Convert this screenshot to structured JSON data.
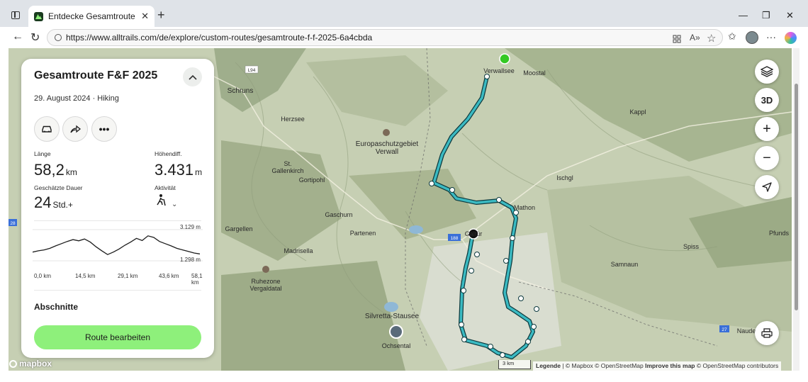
{
  "browser": {
    "tab_title": "Entdecke Gesamtroute F&F 2025",
    "tab_close": "✕",
    "new_tab": "+",
    "url": "https://www.alltrails.com/de/explore/custom-routes/gesamtroute-f-f-2025-6a4cbda",
    "window_min": "—",
    "window_max": "❐",
    "window_close": "✕",
    "back": "←",
    "reload": "↻",
    "more": "···"
  },
  "panel": {
    "title": "Gesamtroute F&F 2025",
    "collapse": "^",
    "date_line": "29. August 2024 · Hiking",
    "stats": {
      "length_label": "Länge",
      "length_value": "58,2",
      "length_unit": "km",
      "elevation_label": "Höhendiff.",
      "elevation_value": "3.431",
      "elevation_unit": "m",
      "duration_label": "Geschätzte Dauer",
      "duration_value": "24",
      "duration_unit": "Std.+",
      "activity_label": "Aktivität"
    },
    "elevation_profile": {
      "max_label": "3.129 m",
      "min_label": "1.298 m",
      "x_labels": [
        "0,0 km",
        "14,5 km",
        "29,1 km",
        "43,6 km",
        "58,1 km"
      ],
      "profile": [
        0.28,
        0.32,
        0.35,
        0.4,
        0.48,
        0.55,
        0.62,
        0.68,
        0.64,
        0.7,
        0.6,
        0.45,
        0.32,
        0.2,
        0.28,
        0.38,
        0.5,
        0.6,
        0.72,
        0.65,
        0.8,
        0.75,
        0.62,
        0.55,
        0.48,
        0.4,
        0.35,
        0.3,
        0.25,
        0.22
      ]
    },
    "section_heading": "Abschnitte",
    "edit_button": "Route bearbeiten"
  },
  "map": {
    "labels": [
      {
        "text": "Verwallsee"
      },
      {
        "text": "Moostal"
      },
      {
        "text": "Schruns"
      },
      {
        "text": "L94"
      },
      {
        "text": "Herzsee"
      },
      {
        "text": "Kappl"
      },
      {
        "text": "Europaschutzgebiet"
      },
      {
        "text": "Verwall"
      },
      {
        "text": "St."
      },
      {
        "text": "Gallenkirch"
      },
      {
        "text": "Gortipohl"
      },
      {
        "text": "Ischgl"
      },
      {
        "text": "Mathon"
      },
      {
        "text": "Gaschurn"
      },
      {
        "text": "Partenen"
      },
      {
        "text": "Gargellen"
      },
      {
        "text": "Galtür"
      },
      {
        "text": "188"
      },
      {
        "text": "Pfunds"
      },
      {
        "text": "Madrisella"
      },
      {
        "text": "Spiss"
      },
      {
        "text": "Samnaun"
      },
      {
        "text": "Ruhezone"
      },
      {
        "text": "Vergaldatal"
      },
      {
        "text": "28"
      },
      {
        "text": "Silvretta-Stausee"
      },
      {
        "text": "Ochsental"
      },
      {
        "text": "27"
      },
      {
        "text": "Naude"
      }
    ],
    "scale_text": "3 km",
    "logo_text": "mapbox",
    "attribution": {
      "legend": "Legende",
      "mid": " | © Mapbox © OpenStreetMap ",
      "improve": "Improve this map",
      "end": " © OpenStreetMap contributors"
    },
    "controls": {
      "layers_icon": "layers-icon",
      "three_d": "3D",
      "zoom_in": "+",
      "zoom_out": "−",
      "locate_icon": "locate-icon",
      "print_icon": "print-icon"
    },
    "colors": {
      "route": "#3bbac2",
      "route_outline": "#0d3a3e",
      "start_marker": "#34c924",
      "end_marker": "#111111",
      "edit_button": "#8ef07b"
    }
  }
}
